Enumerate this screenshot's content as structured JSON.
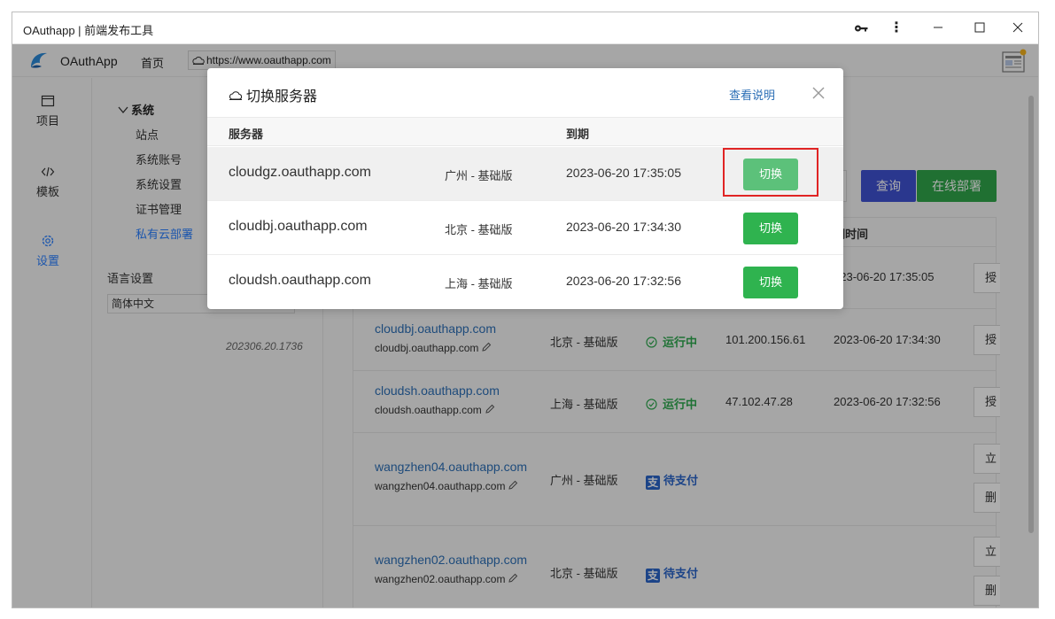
{
  "window": {
    "title": "OAuthapp | 前端发布工具"
  },
  "header": {
    "app_name": "OAuthApp",
    "home_label": "首页",
    "url": "https://www.oauthapp.com"
  },
  "iconbar": {
    "items": [
      {
        "label": "项目"
      },
      {
        "label": "模板"
      },
      {
        "label": "设置"
      }
    ]
  },
  "settings": {
    "tree_root": "系统",
    "items": [
      "站点",
      "系统账号",
      "系统设置",
      "证书管理",
      "私有云部署"
    ],
    "lang_label": "语言设置",
    "lang_value": "简体中文",
    "version": "202306.20.1736"
  },
  "main": {
    "query_label": "查询",
    "deploy_label": "在线部署",
    "expiry_header": "期时间",
    "rows": [
      {
        "expire": "023-06-20 17:35:05",
        "op": "授"
      },
      {
        "domain": "cloudbj.oauthapp.com",
        "sub": "cloudbj.oauthapp.com",
        "region": "北京 - 基础版",
        "status": "运行中",
        "ip": "101.200.156.61",
        "expire": "2023-06-20 17:34:30",
        "op": "授"
      },
      {
        "domain": "cloudsh.oauthapp.com",
        "sub": "cloudsh.oauthapp.com",
        "region": "上海 - 基础版",
        "status": "运行中",
        "ip": "47.102.47.28",
        "expire": "2023-06-20 17:32:56",
        "op": "授"
      },
      {
        "domain": "wangzhen04.oauthapp.com",
        "sub": "wangzhen04.oauthapp.com",
        "region": "广州 - 基础版",
        "pay": "待支付",
        "pay_icon": "支",
        "op1": "立",
        "op2": "删"
      },
      {
        "domain": "wangzhen02.oauthapp.com",
        "sub": "wangzhen02.oauthapp.com",
        "region": "北京 - 基础版",
        "pay": "待支付",
        "pay_icon": "支",
        "op1": "立",
        "op2": "删"
      }
    ]
  },
  "modal": {
    "title": "切换服务器",
    "help_link": "查看说明",
    "col_server": "服务器",
    "col_expiry": "到期",
    "rows": [
      {
        "host": "cloudgz.oauthapp.com",
        "region": "广州 - 基础版",
        "expire": "2023-06-20 17:35:05",
        "button": "切换"
      },
      {
        "host": "cloudbj.oauthapp.com",
        "region": "北京 - 基础版",
        "expire": "2023-06-20 17:34:30",
        "button": "切换"
      },
      {
        "host": "cloudsh.oauthapp.com",
        "region": "上海 - 基础版",
        "expire": "2023-06-20 17:32:56",
        "button": "切换"
      }
    ]
  },
  "colors": {
    "link_blue": "#2d6fb6",
    "active_blue": "#2a7fff",
    "query_blue": "#3f51d1",
    "deploy_green": "#30a54a",
    "switch_green": "#2fb34f",
    "running_green": "#2fa84f",
    "highlight_red": "#e02424"
  }
}
